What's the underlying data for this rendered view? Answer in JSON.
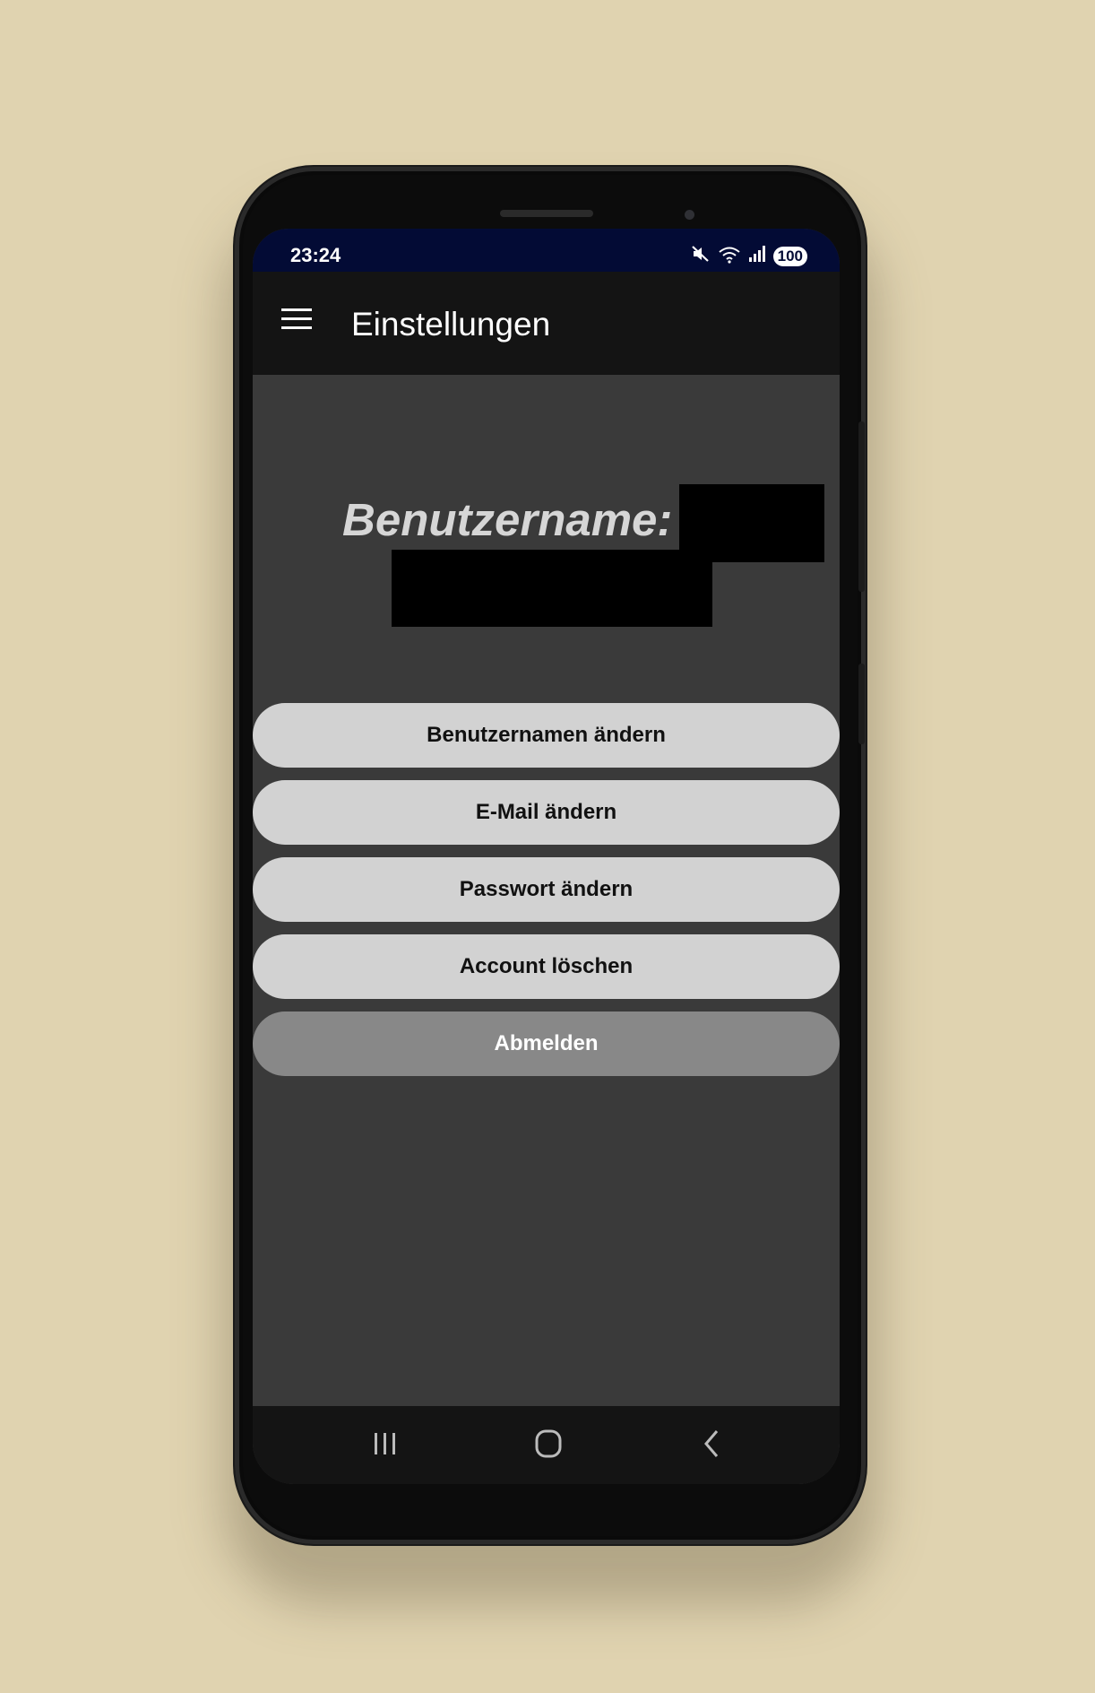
{
  "status_bar": {
    "time": "23:24",
    "icons": [
      "mute-icon",
      "wifi-icon",
      "signal-icon"
    ],
    "battery": "100"
  },
  "app_bar": {
    "title": "Einstellungen",
    "menu_icon": "hamburger-menu-icon"
  },
  "profile": {
    "username_label": "Benutzername:"
  },
  "actions": {
    "change_username": "Benutzernamen ändern",
    "change_email": "E-Mail ändern",
    "change_password": "Passwort ändern",
    "delete_account": "Account löschen",
    "logout": "Abmelden"
  },
  "nav_bar": {
    "icons": [
      "recents-icon",
      "home-icon",
      "back-icon"
    ]
  },
  "colors": {
    "background": "#e0d3b0",
    "status_bar": "#030b35",
    "app_bar": "#141414",
    "content": "#3a3a3a",
    "button_light": "#d2d2d2",
    "button_dark": "#888888"
  }
}
